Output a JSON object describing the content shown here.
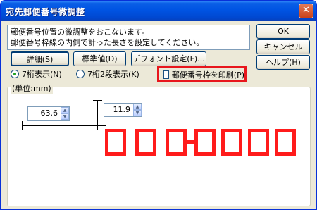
{
  "window": {
    "title": "宛先郵便番号微調整",
    "close_glyph": "✕"
  },
  "description": {
    "line1": "郵便番号位置の微調整をおこないます。",
    "line2": "郵便番号枠線の内側で計った長さを設定してください。"
  },
  "buttons": {
    "detail": "詳細(S)",
    "standard": "標準値(D)",
    "font": "デフォント設定(F)...",
    "ok": "OK",
    "cancel": "キャンセル",
    "help": "ヘルプ(H)"
  },
  "radios": {
    "seven_digit": "7桁表示(N)",
    "seven_digit_two_rows": "7桁2段表示(K)"
  },
  "checkbox": {
    "print_frame": "郵便番号枠を印刷(P)"
  },
  "group": {
    "label": "(単位:mm)"
  },
  "spinners": {
    "horizontal": "63.6",
    "vertical": "11.9"
  },
  "colors": {
    "highlight": "#e8161c",
    "postal_boxes": "#ff1b1b"
  }
}
